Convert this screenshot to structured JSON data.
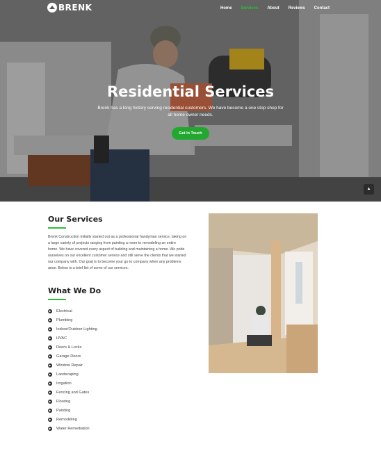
{
  "nav": {
    "logo": "BRENK",
    "items": [
      {
        "label": "Home",
        "active": false
      },
      {
        "label": "Services",
        "active": true
      },
      {
        "label": "About",
        "active": false
      },
      {
        "label": "Reviews",
        "active": false
      },
      {
        "label": "Contact",
        "active": false
      }
    ]
  },
  "hero": {
    "title": "Residential Services",
    "subtitle": "Brenk has a long history serving residential customers. We have become a one stop shop for all home owner needs.",
    "button": "Get In Touch"
  },
  "services": {
    "heading": "Our Services",
    "intro": "Brenk Construction initially started out as a professional handyman service, taking on a large variety of projects ranging from painting a room to remodeling an entire home. We have covered every aspect of building and maintaining a home. We pride ourselves on our excellent customer service and still serve the clients that we started our company with. Our goal is to become your go to company when any problems arise. Below is a brief list of some of our services.",
    "list_heading": "What We Do",
    "items": [
      "Electrical",
      "Plumbing",
      "Indoor/Outdoor Lighting",
      "HVAC",
      "Doors & Locks",
      "Garage Doors",
      "Window Repair",
      "Landscaping",
      "Irrigation",
      "Fencing and Gates",
      "Flooring",
      "Painting",
      "Remodeling",
      "Water Remediation"
    ]
  },
  "colors": {
    "accent": "#2bbf3a",
    "button": "#22a82f"
  },
  "icons": {
    "bullet": "chevron-circle-right-icon",
    "scroll": "chevron-up-icon"
  }
}
